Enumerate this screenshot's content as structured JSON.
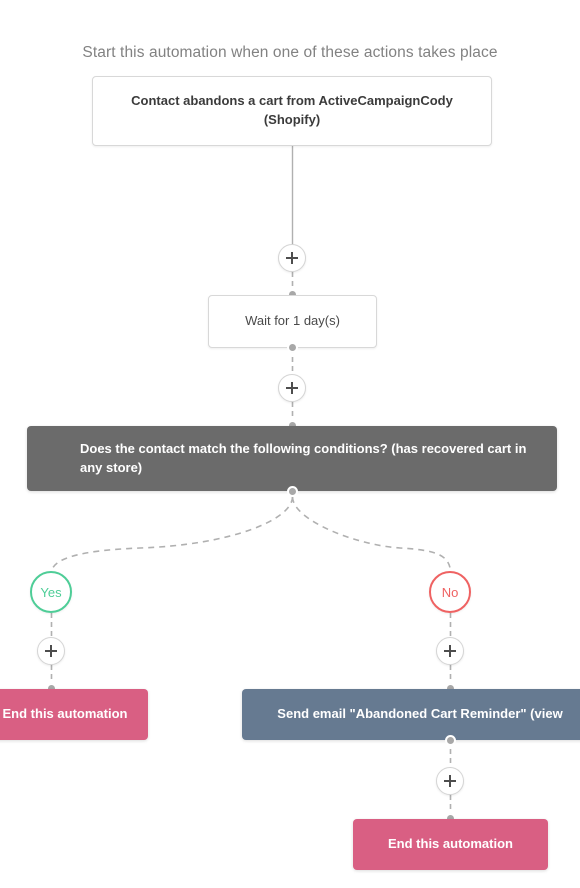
{
  "heading": "Start this automation when one of these actions takes place",
  "nodes": {
    "trigger": {
      "label": "Contact abandons a cart from ActiveCampaignCody (Shopify)"
    },
    "wait": {
      "label": "Wait for 1 day(s)"
    },
    "condition": {
      "label": "Does the contact match the following conditions? (has recovered cart in any store)"
    },
    "branch_yes": {
      "label": "Yes"
    },
    "branch_no": {
      "label": "No"
    },
    "end_left": {
      "label": "End this automation"
    },
    "email": {
      "label": "Send email \"Abandoned Cart Reminder\" (view"
    },
    "end_right": {
      "label": "End this automation"
    }
  },
  "buttons": {
    "add_step": "+"
  },
  "colors": {
    "condition_bg": "#6b6b6b",
    "email_bg": "#667a91",
    "end_bg": "#d95f83",
    "yes_accent": "#4ecd97",
    "no_accent": "#ef6262",
    "connector": "#b0b0b0",
    "heading_text": "#828282"
  }
}
